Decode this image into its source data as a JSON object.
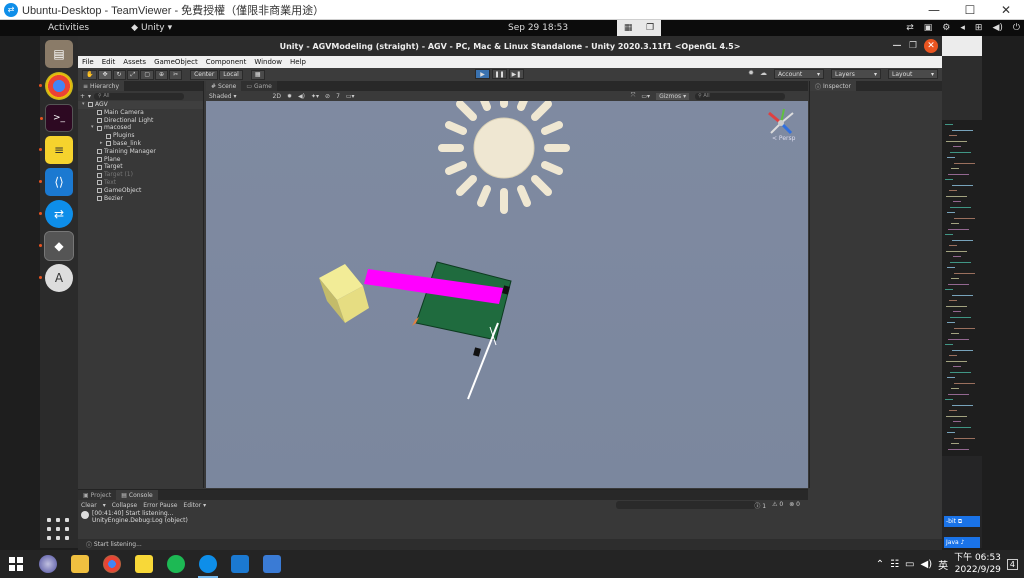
{
  "teamviewer": {
    "title": "Ubuntu-Desktop - TeamViewer - 免費授權（僅限非商業用途）"
  },
  "ubuntu": {
    "activities": "Activities",
    "app_name": "Unity",
    "clock": "Sep 29  18:53"
  },
  "unity": {
    "window_title": "Unity - AGVModeling (straight) - AGV - PC, Mac & Linux Standalone - Unity 2020.3.11f1 <OpenGL 4.5>",
    "menu": [
      "File",
      "Edit",
      "Assets",
      "GameObject",
      "Component",
      "Window",
      "Help"
    ],
    "toolbar": {
      "center": "Center",
      "local": "Local",
      "account": "Account",
      "layers": "Layers",
      "layout": "Layout"
    },
    "hierarchy": {
      "tab": "Hierarchy",
      "search_placeholder": "All",
      "add": "+",
      "items": [
        {
          "label": "AGV",
          "indent": 0,
          "kind": "root"
        },
        {
          "label": "Main Camera",
          "indent": 1,
          "kind": "item"
        },
        {
          "label": "Directional Light",
          "indent": 1,
          "kind": "item"
        },
        {
          "label": "macosed",
          "indent": 1,
          "kind": "parent"
        },
        {
          "label": "Plugins",
          "indent": 2,
          "kind": "item"
        },
        {
          "label": "base_link",
          "indent": 2,
          "kind": "parent-collapsed"
        },
        {
          "label": "Training Manager",
          "indent": 1,
          "kind": "item"
        },
        {
          "label": "Plane",
          "indent": 1,
          "kind": "item"
        },
        {
          "label": "Target",
          "indent": 1,
          "kind": "item"
        },
        {
          "label": "Target (1)",
          "indent": 1,
          "kind": "disabled"
        },
        {
          "label": "Text",
          "indent": 1,
          "kind": "disabled"
        },
        {
          "label": "GameObject",
          "indent": 1,
          "kind": "item"
        },
        {
          "label": "Bezier",
          "indent": 1,
          "kind": "item"
        }
      ]
    },
    "scene": {
      "tab_scene": "Scene",
      "tab_game": "Game",
      "shading": "Shaded",
      "mode_2d": "2D",
      "gizmos": "Gizmos",
      "search": "All",
      "layer_count": "7",
      "persp": "< Persp"
    },
    "inspector": {
      "tab": "Inspector"
    },
    "console": {
      "tab_project": "Project",
      "tab_console": "Console",
      "clear": "Clear",
      "collapse": "Collapse",
      "error_pause": "Error Pause",
      "editor": "Editor",
      "count_info": "1",
      "count_warn": "0",
      "count_error": "0",
      "log_line1": "[00:41:40] Start listening...",
      "log_line2": "UnityEngine.Debug:Log (object)"
    },
    "status": "Start listening..."
  },
  "right_panel": {
    "btn1": "-bit",
    "btn2": "Java"
  },
  "windows_taskbar": {
    "time": "下午 06:53",
    "date": "2022/9/29",
    "ime": "英",
    "notif": "4"
  },
  "colors": {
    "ubuntu_orange": "#e95420",
    "unity_dark": "#383838",
    "scene_bg": "#7e8aa0",
    "box_green": "#1f6b3e",
    "magenta": "#ff00ff",
    "yellow_cube": "#ece78c"
  }
}
